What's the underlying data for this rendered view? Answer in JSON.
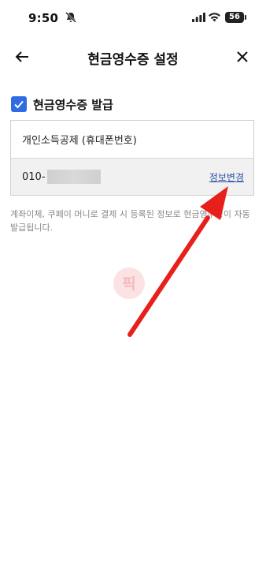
{
  "status_bar": {
    "time": "9:50",
    "battery": "56"
  },
  "header": {
    "title": "현금영수증 설정"
  },
  "receipt": {
    "toggle_label": "현금영수증 발급",
    "checked": true,
    "type": "개인소득공제 (휴대폰번호)",
    "phone_prefix": "010-",
    "change_link": "정보변경"
  },
  "notice": "계좌이체, 쿠페이 머니로 결제 시 등록된 정보로 현금영수증이 자동 발급됩니다.",
  "watermark": {
    "text": "픽"
  },
  "colors": {
    "accent": "#2f6be3",
    "link": "#2a4ea0",
    "arrow": "#e8201c"
  }
}
